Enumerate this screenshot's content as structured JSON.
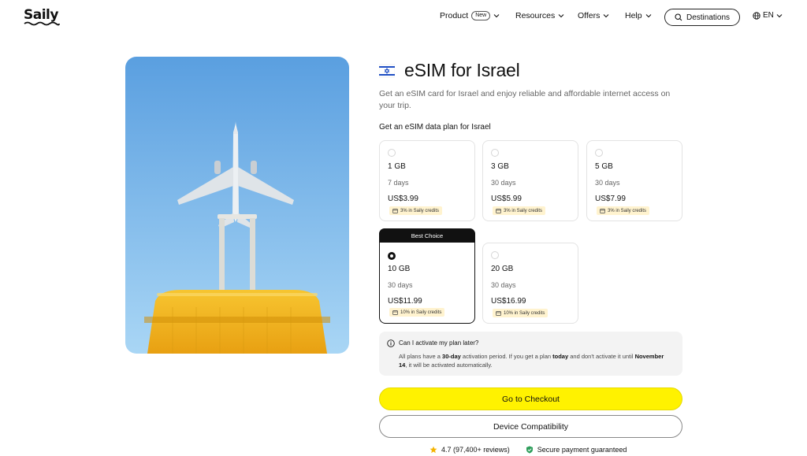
{
  "nav": {
    "logo": "Saily",
    "product_label": "Product",
    "new_badge": "New",
    "resources_label": "Resources",
    "offers_label": "Offers",
    "help_label": "Help",
    "destinations_label": "Destinations",
    "language_label": "EN"
  },
  "page": {
    "title": "eSIM for Israel",
    "subtitle": "Get an eSIM card for Israel and enjoy reliable and affordable internet access on your trip.",
    "plan_heading": "Get an eSIM data plan for Israel"
  },
  "plans": [
    {
      "data": "1 GB",
      "days": "7 days",
      "price": "US$3.99",
      "credit": "3% in Saily credits"
    },
    {
      "data": "3 GB",
      "days": "30 days",
      "price": "US$5.99",
      "credit": "3% in Saily credits"
    },
    {
      "data": "5 GB",
      "days": "30 days",
      "price": "US$7.99",
      "credit": "3% in Saily credits"
    },
    {
      "data": "10 GB",
      "days": "30 days",
      "price": "US$11.99",
      "credit": "10% in Saily credits",
      "badge": "Best Choice"
    },
    {
      "data": "20 GB",
      "days": "30 days",
      "price": "US$16.99",
      "credit": "10% in Saily credits"
    }
  ],
  "info": {
    "question": "Can I activate my plan later?",
    "answer_p1": "All plans have a ",
    "answer_b1": "30-day",
    "answer_p2": " activation period. If you get a plan ",
    "answer_b2": "today",
    "answer_p3": " and don't activate it until ",
    "answer_b3": "November 14",
    "answer_p4": ", it will be activated automatically."
  },
  "buttons": {
    "checkout": "Go to Checkout",
    "compatibility": "Device Compatibility"
  },
  "footer": {
    "rating": "4.7 (97,400+ reviews)",
    "secure": "Secure payment guaranteed"
  },
  "colors": {
    "accent_yellow": "#fff200",
    "credit_bg": "#fff3cf",
    "sky_top": "#5a9fe0",
    "sky_bottom": "#a9d6f5",
    "suitcase": "#f3b21c"
  },
  "icons": [
    "chevron-down-icon",
    "search-icon",
    "globe-icon",
    "israel-flag-icon",
    "info-icon",
    "star-icon",
    "shield-check-icon",
    "credit-card-icon"
  ]
}
